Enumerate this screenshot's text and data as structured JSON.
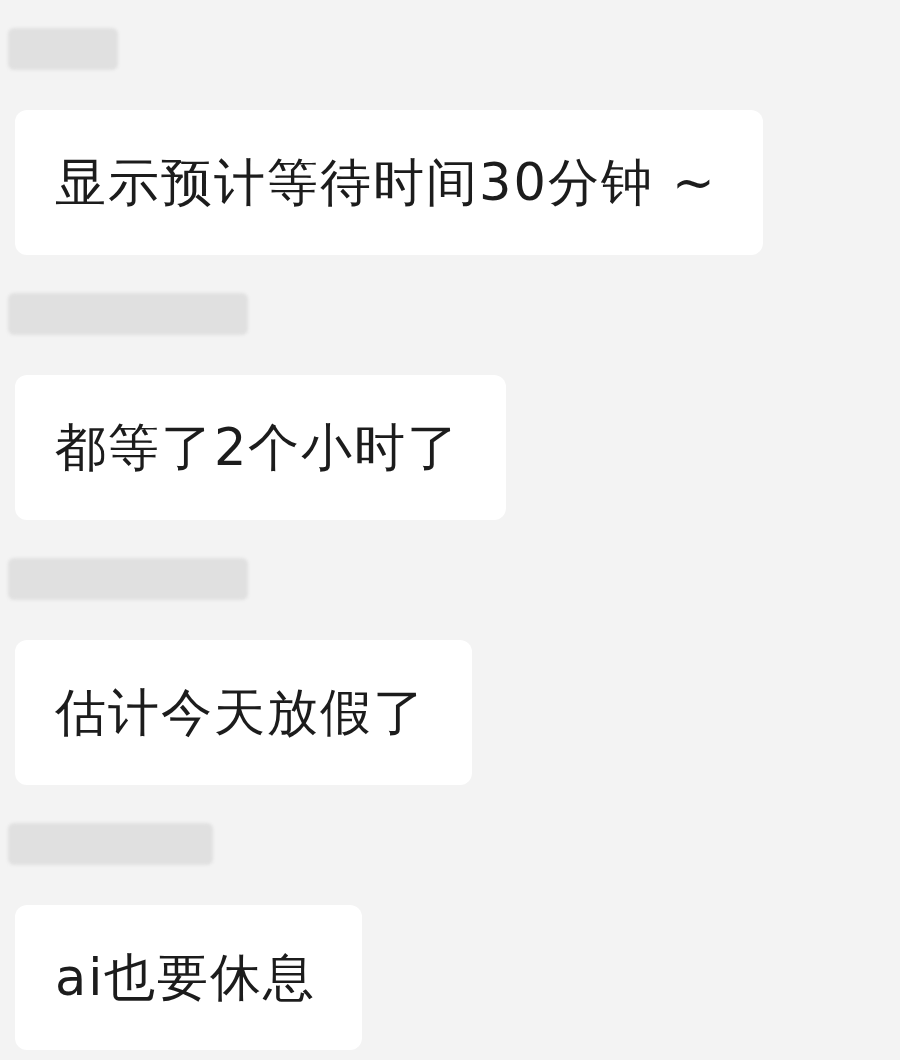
{
  "messages": [
    {
      "text": "显示预计等待时间30分钟 ~"
    },
    {
      "text": "都等了2个小时了"
    },
    {
      "text": "估计今天放假了"
    },
    {
      "text": "ai也要休息"
    }
  ]
}
